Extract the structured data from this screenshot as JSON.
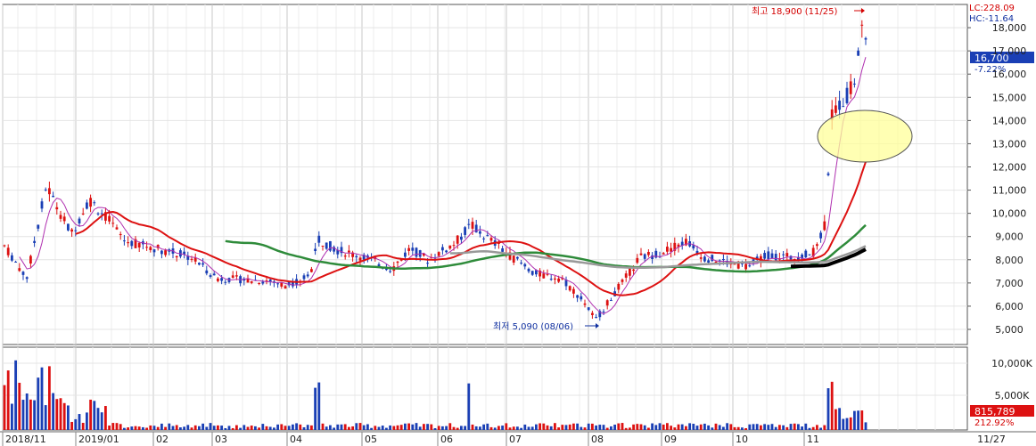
{
  "chart_data": {
    "type": "candlestick",
    "price_axis": {
      "ticks": [
        "5,000",
        "6,000",
        "7,000",
        "8,000",
        "9,000",
        "10,000",
        "11,000",
        "12,000",
        "13,000",
        "14,000",
        "15,000",
        "16,000",
        "17,000",
        "18,000"
      ],
      "ylim": [
        4700,
        18700
      ]
    },
    "volume_axis": {
      "ticks": [
        "5,000K",
        "10,000K"
      ]
    },
    "x_labels": [
      "2018/11",
      "2019/01",
      "02",
      "03",
      "04",
      "05",
      "06",
      "07",
      "08",
      "09",
      "10",
      "11"
    ],
    "date_footer": "11/27",
    "price_series": [
      {
        "date": "2018-11",
        "close": 8600
      },
      {
        "date": "2018-12",
        "close": 11200
      },
      {
        "date": "2019-01",
        "close": 10000
      },
      {
        "date": "2019-02",
        "close": 8300
      },
      {
        "date": "2019-03",
        "close": 7200
      },
      {
        "date": "2019-04",
        "close": 8300
      },
      {
        "date": "2019-05",
        "close": 8200
      },
      {
        "date": "2019-06",
        "close": 9300
      },
      {
        "date": "2019-07",
        "close": 7500
      },
      {
        "date": "2019-08",
        "close": 5800
      },
      {
        "date": "2019-09",
        "close": 8600
      },
      {
        "date": "2019-10",
        "close": 7900
      },
      {
        "date": "2019-11",
        "close": 16700
      }
    ],
    "moving_averages": [
      {
        "color": "#dd1111"
      },
      {
        "color": "#2e8b3a"
      },
      {
        "color": "#999999"
      },
      {
        "color": "#000000"
      }
    ],
    "annotations": {
      "high": "최고 18,900 (11/25)",
      "low": "최저 5,090 (08/06)"
    },
    "top_info": {
      "lc": "LC:228.09",
      "hc": "HC:-11.64"
    },
    "current": {
      "price": "16,700",
      "change": "-7.22%"
    },
    "volume_current": {
      "value": "815,789",
      "pct": "212.92%"
    },
    "colors": {
      "up": "#dd1111",
      "down": "#1a3fb5",
      "highlight": "#ffff99"
    }
  }
}
